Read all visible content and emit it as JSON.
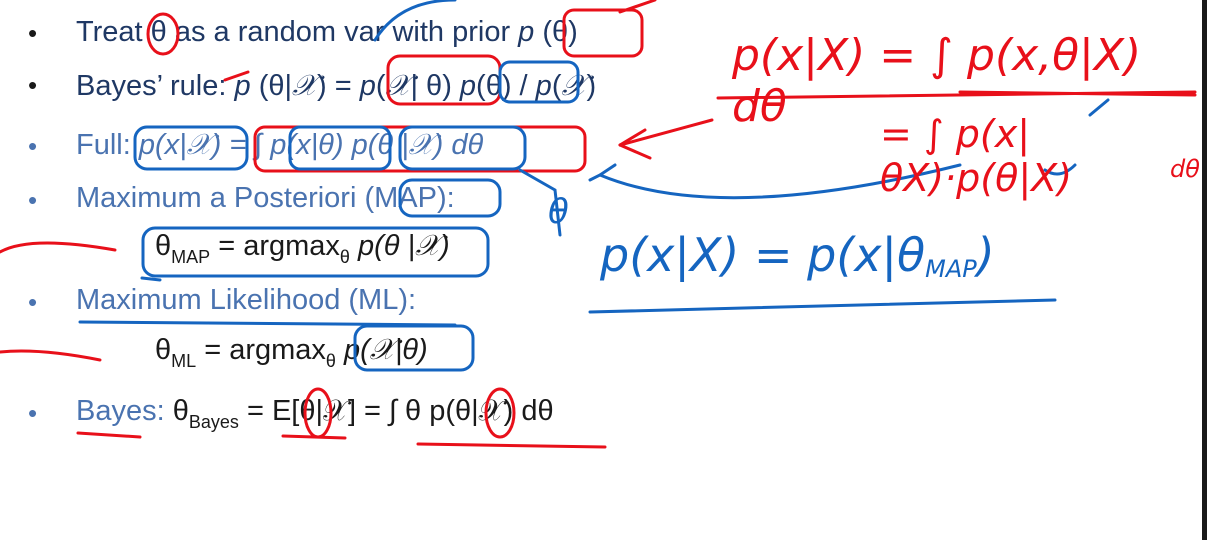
{
  "slide": {
    "bullets": [
      {
        "pre": "Treat ",
        "theta": "θ",
        "mid": " as a random var with prior ",
        "p": "p",
        "post": " (θ)"
      },
      {
        "label": "Bayes’ rule: ",
        "eq_a": "p",
        "eq_b": " (θ|",
        "X": "𝒳",
        "eq_c": ") = ",
        "eq_d": "p",
        "eq_e": "(",
        "eq_f": "| θ) ",
        "eq_g": "p",
        "eq_h": "(θ) / ",
        "eq_i": "p",
        "eq_j": "(",
        "eq_k": ")"
      },
      {
        "label": "Full: ",
        "eq": "p(x|𝒳) = ∫ p(x|θ) p(θ |𝒳) dθ"
      },
      {
        "label": "Maximum a Posteriori (MAP):"
      },
      {
        "theta": "θ",
        "sub": "MAP",
        "eq": " = argmax",
        "sub2": "θ",
        "eq2": " p(θ |𝒳)"
      },
      {
        "label": "Maximum Likelihood (ML):"
      },
      {
        "theta": "θ",
        "sub": "ML",
        "eq": " = argmax",
        "sub2": "θ",
        "eq2": " p(𝒳|θ)"
      },
      {
        "label": "Bayes: ",
        "theta": "θ",
        "sub": "Bayes",
        "eq": " = E[θ|𝒳] = ∫ θ p(θ|𝒳) dθ"
      }
    ],
    "bullet_char": "•"
  },
  "handwriting": {
    "top_eq": "p(x|X) = ∫ p(x,θ|X) dθ",
    "second_eq": "= ∫ p(x|θX)·p(θ|X)",
    "second_tail": "dθ",
    "map_eq": "p(x|X) = p(x|θ",
    "map_sub": "MAP",
    "map_close": ")",
    "theta_mark": "θ"
  },
  "colors": {
    "text_dark": "#1f3864",
    "text_light": "#4a73b0",
    "ink_red": "#e8101a",
    "ink_blue": "#1565c0"
  }
}
